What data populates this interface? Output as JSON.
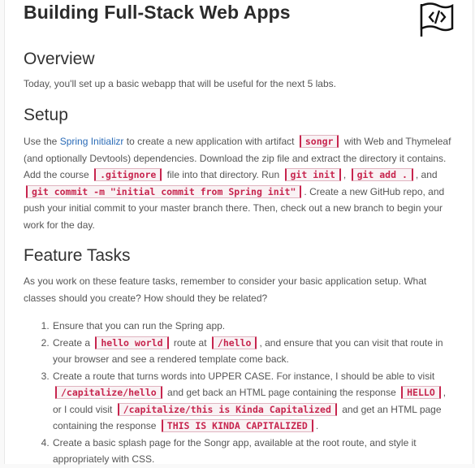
{
  "title": "Building Full-Stack Web Apps",
  "overview": {
    "heading": "Overview",
    "text": "Today, you'll set up a basic webapp that will be useful for the next 5 labs."
  },
  "setup": {
    "heading": "Setup",
    "t1": "Use the ",
    "link": "Spring Initializr",
    "t2": " to create a new application with artifact ",
    "c1": "songr",
    "t3": " with Web and Thymeleaf (and optionally Devtools) dependencies. Download the zip file and extract the directory it contains. Add the course ",
    "c2": ".gitignore",
    "t4": " file into that directory. Run ",
    "c3": "git init",
    "t5": ", ",
    "c4": "git add .",
    "t6": ", and ",
    "c5": "git commit -m \"initial commit from Spring init\"",
    "t7": ". Create a new GitHub repo, and push your initial commit to your master branch there. Then, check out a new branch to begin your work for the day."
  },
  "features": {
    "heading": "Feature Tasks",
    "intro": "As you work on these feature tasks, remember to consider your basic application setup. What classes should you create? How should they be related?",
    "item1": "Ensure that you can run the Spring app.",
    "item2": {
      "a": "Create a ",
      "c1": "hello world",
      "b": " route at ",
      "c2": "/hello",
      "c": ", and ensure that you can visit that route in your browser and see a rendered template come back."
    },
    "item3": {
      "a": "Create a route that turns words into UPPER CASE. For instance, I should be able to visit ",
      "c1": "/capitalize/hello",
      "b": " and get back an HTML page containing the response ",
      "c2": "HELLO",
      "c": ", or I could visit ",
      "c3": "/capitalize/this is Kinda Capitalized",
      "d": " and get an HTML page containing the response ",
      "c4": "THIS IS KINDA CAPITALIZED",
      "e": "."
    },
    "item4": "Create a basic splash page for the Songr app, available at the root route, and style it appropriately with CSS."
  }
}
